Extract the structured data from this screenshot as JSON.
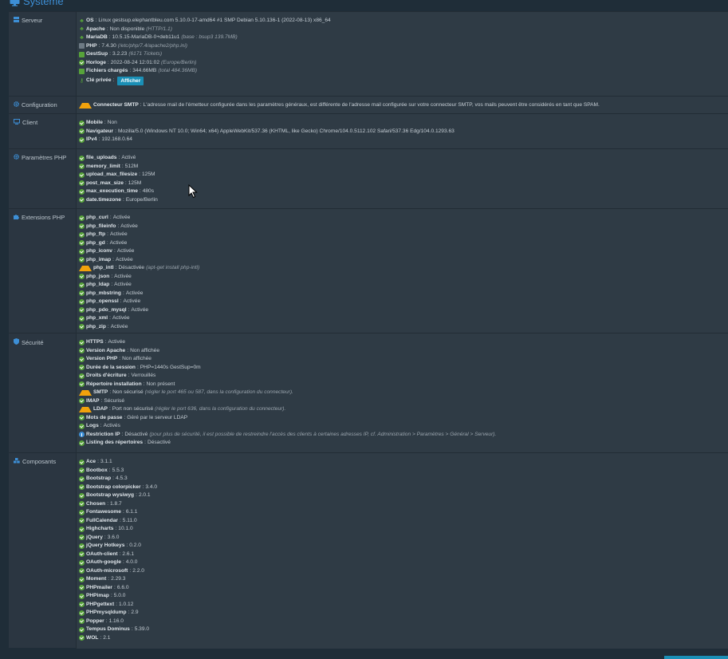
{
  "page": {
    "title": "Système"
  },
  "sections": [
    {
      "label": "Serveur",
      "icon": "server-icon",
      "rows": [
        {
          "icon": "leaf",
          "k": "OS",
          "v": "Linux gestsup.elephantbleu.com 5.10.0-17-amd64 #1 SMP Debian 5.10.136-1 (2022-08-13) x86_64",
          "n": ""
        },
        {
          "icon": "leaf",
          "k": "Apache",
          "v": "Non disponible",
          "n": "(HTTP/1.1)"
        },
        {
          "icon": "leaf",
          "k": "MariaDB",
          "v": "10.5.15-MariaDB-0+deb11u1",
          "n": "(base : bsup3 139.7MB)"
        },
        {
          "icon": "grey",
          "k": "PHP",
          "v": "7.4.30",
          "n": "(/etc/php/7.4/apache2/php.ini)"
        },
        {
          "icon": "sq",
          "k": "GestSup",
          "v": "3.2.23",
          "n": "(6171 Tickets)"
        },
        {
          "icon": "ok",
          "k": "Horloge",
          "v": "2022-08-24 12:01:02",
          "n": "(Europe/Berlin)"
        },
        {
          "icon": "sq",
          "k": "Fichiers chargés",
          "v": "344.66MB",
          "n": "(total 484.36MB)"
        },
        {
          "icon": "key",
          "k": "Clé privée",
          "v": "",
          "n": "",
          "button": "Afficher"
        }
      ]
    },
    {
      "label": "Configuration",
      "icon": "gear-icon",
      "rows": [
        {
          "icon": "warn",
          "k": "Connecteur SMTP",
          "v": "L'adresse mail de l'émetteur configurée dans les paramètres généraux, est différente de l'adresse mail configurée sur votre connecteur SMTP, vos mails peuvent être considérés en tant que SPAM.",
          "n": ""
        }
      ]
    },
    {
      "label": "Client",
      "icon": "monitor-icon",
      "rows": [
        {
          "icon": "ok",
          "k": "Mobile",
          "v": "Non",
          "n": ""
        },
        {
          "icon": "ok",
          "k": "Navigateur",
          "v": "Mozilla/5.0 (Windows NT 10.0; Win64; x64) AppleWebKit/537.36 (KHTML, like Gecko) Chrome/104.0.5112.102 Safari/537.36 Edg/104.0.1293.63",
          "n": ""
        },
        {
          "icon": "ok",
          "k": "IPv4",
          "v": "192.168.0.64",
          "n": ""
        }
      ]
    },
    {
      "label": "Paramètres PHP",
      "icon": "gear-icon",
      "rows": [
        {
          "icon": "ok",
          "k": "file_uploads",
          "v": "Activé",
          "n": ""
        },
        {
          "icon": "ok",
          "k": "memory_limit",
          "v": "512M",
          "n": ""
        },
        {
          "icon": "ok",
          "k": "upload_max_filesize",
          "v": "125M",
          "n": ""
        },
        {
          "icon": "ok",
          "k": "post_max_size",
          "v": "125M",
          "n": ""
        },
        {
          "icon": "ok",
          "k": "max_execution_time",
          "v": "480s",
          "n": ""
        },
        {
          "icon": "ok",
          "k": "date.timezone",
          "v": "Europe/Berlin",
          "n": ""
        }
      ]
    },
    {
      "label": "Extensions PHP",
      "icon": "puzzle-icon",
      "rows": [
        {
          "icon": "ok",
          "k": "php_curl",
          "v": "Activée",
          "n": ""
        },
        {
          "icon": "ok",
          "k": "php_fileinfo",
          "v": "Activée",
          "n": ""
        },
        {
          "icon": "ok",
          "k": "php_ftp",
          "v": "Activée",
          "n": ""
        },
        {
          "icon": "ok",
          "k": "php_gd",
          "v": "Activée",
          "n": ""
        },
        {
          "icon": "ok",
          "k": "php_iconv",
          "v": "Activée",
          "n": ""
        },
        {
          "icon": "ok",
          "k": "php_imap",
          "v": "Activée",
          "n": ""
        },
        {
          "icon": "warn",
          "k": "php_intl",
          "v": "Désactivée",
          "n": "(apt-get install php-intl)"
        },
        {
          "icon": "ok",
          "k": "php_json",
          "v": "Activée",
          "n": ""
        },
        {
          "icon": "ok",
          "k": "php_ldap",
          "v": "Activée",
          "n": ""
        },
        {
          "icon": "ok",
          "k": "php_mbstring",
          "v": "Activée",
          "n": ""
        },
        {
          "icon": "ok",
          "k": "php_openssl",
          "v": "Activée",
          "n": ""
        },
        {
          "icon": "ok",
          "k": "php_pdo_mysql",
          "v": "Activée",
          "n": ""
        },
        {
          "icon": "ok",
          "k": "php_xml",
          "v": "Activée",
          "n": ""
        },
        {
          "icon": "ok",
          "k": "php_zip",
          "v": "Activée",
          "n": ""
        }
      ]
    },
    {
      "label": "Sécurité",
      "icon": "shield-icon",
      "rows": [
        {
          "icon": "ok",
          "k": "HTTPS",
          "v": "Activée",
          "n": ""
        },
        {
          "icon": "ok",
          "k": "Version Apache",
          "v": "Non affichée",
          "n": ""
        },
        {
          "icon": "ok",
          "k": "Version PHP",
          "v": "Non affichée",
          "n": ""
        },
        {
          "icon": "ok",
          "k": "Durée de la session",
          "v": "PHP=1440s GestSup=0m",
          "n": ""
        },
        {
          "icon": "ok",
          "k": "Droits d'écriture",
          "v": "Verrouillés",
          "n": ""
        },
        {
          "icon": "ok",
          "k": "Répertoire installation",
          "v": "Non présent",
          "n": ""
        },
        {
          "icon": "warn",
          "k": "SMTP",
          "v": "Non sécurisé",
          "n": "(régler le port 465 ou 587, dans la configuration du connecteur)."
        },
        {
          "icon": "ok",
          "k": "IMAP",
          "v": "Sécurisé",
          "n": ""
        },
        {
          "icon": "warn",
          "k": "LDAP",
          "v": "Port non sécurisé",
          "n": "(régler le port 636, dans la configuration du connecteur)."
        },
        {
          "icon": "ok",
          "k": "Mots de passe",
          "v": "Géré par le serveur LDAP",
          "n": ""
        },
        {
          "icon": "ok",
          "k": "Logs",
          "v": "Activés",
          "n": ""
        },
        {
          "icon": "info",
          "k": "Restriction IP",
          "v": "Désactivé",
          "n": "(pour plus de sécurité, il est possible de restreindre l'accès des clients à certaines adresses IP, cf. Administration > Paramètres > Général > Serveur)."
        },
        {
          "icon": "ok",
          "k": "Listing des répertoires",
          "v": "Désactivé",
          "n": ""
        }
      ]
    },
    {
      "label": "Composants",
      "icon": "cubes-icon",
      "rows": [
        {
          "icon": "ok",
          "k": "Ace",
          "v": "3.1.1",
          "n": ""
        },
        {
          "icon": "ok",
          "k": "Bootbox",
          "v": "5.5.3",
          "n": ""
        },
        {
          "icon": "ok",
          "k": "Bootstrap",
          "v": "4.5.3",
          "n": ""
        },
        {
          "icon": "ok",
          "k": "Bootstrap colorpicker",
          "v": "3.4.0",
          "n": ""
        },
        {
          "icon": "ok",
          "k": "Bootstrap wysiwyg",
          "v": "2.0.1",
          "n": ""
        },
        {
          "icon": "ok",
          "k": "Chosen",
          "v": "1.8.7",
          "n": ""
        },
        {
          "icon": "ok",
          "k": "Fontawesome",
          "v": "6.1.1",
          "n": ""
        },
        {
          "icon": "ok",
          "k": "FullCalendar",
          "v": "5.11.0",
          "n": ""
        },
        {
          "icon": "ok",
          "k": "Highcharts",
          "v": "10.1.0",
          "n": ""
        },
        {
          "icon": "ok",
          "k": "jQuery",
          "v": "3.6.0",
          "n": ""
        },
        {
          "icon": "ok",
          "k": "jQuery Hotkeys",
          "v": "0.2.0",
          "n": ""
        },
        {
          "icon": "ok",
          "k": "OAuth-client",
          "v": "2.6.1",
          "n": ""
        },
        {
          "icon": "ok",
          "k": "OAuth-google",
          "v": "4.0.0",
          "n": ""
        },
        {
          "icon": "ok",
          "k": "OAuth-microsoft",
          "v": "2.2.0",
          "n": ""
        },
        {
          "icon": "ok",
          "k": "Moment",
          "v": "2.29.3",
          "n": ""
        },
        {
          "icon": "ok",
          "k": "PHPmailer",
          "v": "6.6.0",
          "n": ""
        },
        {
          "icon": "ok",
          "k": "PHPimap",
          "v": "5.0.0",
          "n": ""
        },
        {
          "icon": "ok",
          "k": "PHPgettext",
          "v": "1.0.12",
          "n": ""
        },
        {
          "icon": "ok",
          "k": "PHPmysqldump",
          "v": "2.9",
          "n": ""
        },
        {
          "icon": "ok",
          "k": "Popper",
          "v": "1.16.0",
          "n": ""
        },
        {
          "icon": "ok",
          "k": "Tempus Dominus",
          "v": "5.39.0",
          "n": ""
        },
        {
          "icon": "ok",
          "k": "WOL",
          "v": "2.1",
          "n": ""
        }
      ]
    }
  ]
}
